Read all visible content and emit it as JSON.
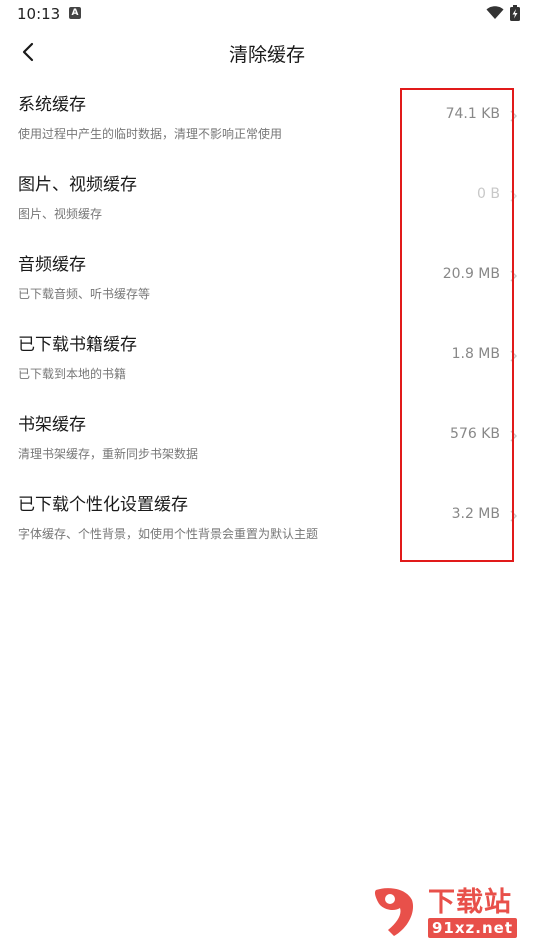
{
  "status_bar": {
    "time": "10:13",
    "a_badge": "A",
    "icons": [
      "wifi-icon",
      "battery-charging-icon"
    ]
  },
  "header": {
    "title": "清除缓存",
    "back_icon": "chevron-left-icon"
  },
  "items": [
    {
      "title": "系统缓存",
      "desc": "使用过程中产生的临时数据，清理不影响正常使用",
      "size": "74.1 KB"
    },
    {
      "title": "图片、视频缓存",
      "desc": "图片、视频缓存",
      "size": "0 B"
    },
    {
      "title": "音频缓存",
      "desc": "已下载音频、听书缓存等",
      "size": "20.9 MB"
    },
    {
      "title": "已下载书籍缓存",
      "desc": "已下载到本地的书籍",
      "size": "1.8 MB"
    },
    {
      "title": "书架缓存",
      "desc": "清理书架缓存，重新同步书架数据",
      "size": "576 KB"
    },
    {
      "title": "已下载个性化设置缓存",
      "desc": "字体缓存、个性背景，如使用个性背景会重置为默认主题",
      "size": "3.2 MB"
    }
  ],
  "colors": {
    "highlight": "#e11a1a",
    "watermark": "#e8504a"
  },
  "watermark": {
    "cn": "下载站",
    "en": "91xz.net"
  }
}
